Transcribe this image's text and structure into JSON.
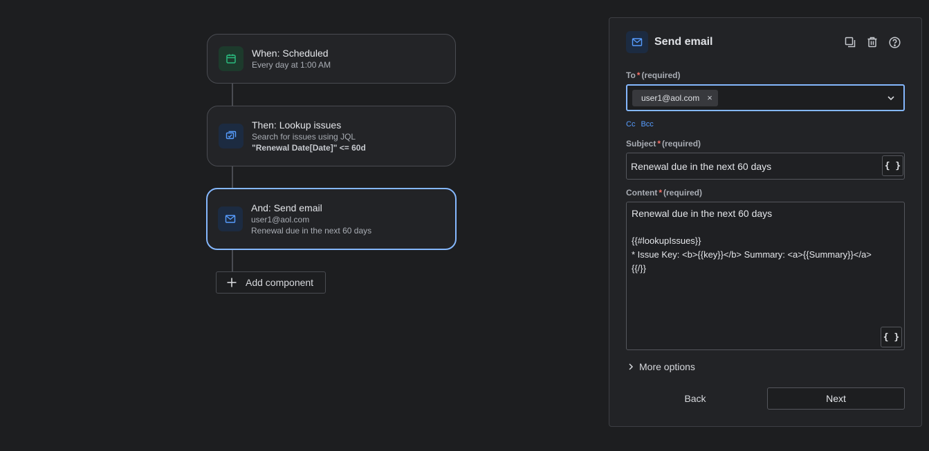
{
  "flow": {
    "nodes": [
      {
        "title": "When: Scheduled",
        "lines": [
          "Every day at 1:00 AM"
        ],
        "icon": "calendar-icon"
      },
      {
        "title": "Then: Lookup issues",
        "lines": [
          "Search for issues using JQL",
          "\"Renewal Date[Date]\" <= 60d"
        ],
        "icon": "lookup-issues-icon"
      },
      {
        "title": "And: Send email",
        "lines": [
          "user1@aol.com",
          "Renewal due in the next 60 days"
        ],
        "icon": "mail-icon"
      }
    ],
    "add_component_label": "Add component"
  },
  "panel": {
    "title": "Send email",
    "icon": "mail-icon",
    "actions": [
      "duplicate-icon",
      "trash-icon",
      "help-icon"
    ],
    "to": {
      "label": "To",
      "required_text": "(required)",
      "chips": [
        "user1@aol.com"
      ],
      "chip_remove": "×"
    },
    "cc_label": "Cc",
    "bcc_label": "Bcc",
    "subject": {
      "label": "Subject",
      "required_text": "(required)",
      "value": "Renewal due in the next 60 days"
    },
    "content": {
      "label": "Content",
      "required_text": "(required)",
      "lines": [
        "Renewal due in the next 60 days",
        "",
        "{{#lookupIssues}}",
        "* Issue Key: <b>{{key}}</b> Summary: <a>{{Summary}}</a>",
        "{{/}}"
      ]
    },
    "variable_button_label": "{ }",
    "more_options_label": "More options",
    "back_label": "Back",
    "next_label": "Next"
  },
  "colors": {
    "background": "#1d1e20",
    "accent_blue": "#85b8ff",
    "link_blue": "#579dff",
    "required_red": "#f87168",
    "schedule_green": "#2abb7f"
  }
}
